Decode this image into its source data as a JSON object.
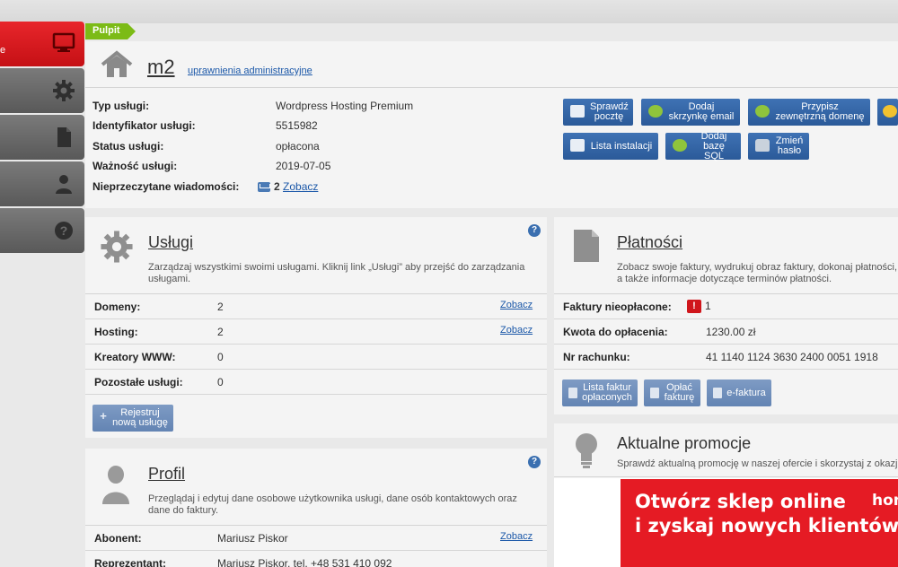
{
  "sidebar": {
    "items": [
      {
        "label": "e",
        "icon": "monitor-icon",
        "active": true
      },
      {
        "label": "",
        "icon": "gear-icon"
      },
      {
        "label": "",
        "icon": "document-icon"
      },
      {
        "label": "",
        "icon": "user-icon"
      },
      {
        "label": "",
        "icon": "help-icon"
      }
    ]
  },
  "breadcrumb": {
    "label": "Pulpit"
  },
  "summary": {
    "service_name": "m2",
    "permissions_link": "uprawnienia administracyjne",
    "rows": [
      {
        "key": "Typ usługi:",
        "value": "Wordpress Hosting Premium"
      },
      {
        "key": "Identyfikator usługi:",
        "value": "5515982"
      },
      {
        "key": "Status usługi:",
        "value": "opłacona"
      },
      {
        "key": "Ważność usługi:",
        "value": "2019-07-05"
      }
    ],
    "unread": {
      "key": "Nieprzeczytane wiadomości:",
      "count": "2",
      "link": "Zobacz"
    }
  },
  "quick_actions": [
    {
      "label": "Sprawdź pocztę",
      "icon": "mail-icon"
    },
    {
      "label": "Dodaj skrzynkę email",
      "icon": "add-mailbox-icon"
    },
    {
      "label": "Przypisz zewnętrzną domenę",
      "icon": "domain-icon"
    },
    {
      "label": "",
      "icon": "lightbulb-icon"
    },
    {
      "label": "Lista instalacji",
      "icon": "install-list-icon"
    },
    {
      "label": "Dodaj bazę SQL",
      "icon": "database-icon"
    },
    {
      "label": "Zmień hasło",
      "icon": "lock-icon"
    }
  ],
  "uslugi": {
    "title": "Usługi",
    "description": "Zarządzaj wszystkimi swoimi usługami. Kliknij link „Usługi” aby przejść do zarządzania usługami.",
    "rows": [
      {
        "key": "Domeny:",
        "value": "2",
        "link": "Zobacz"
      },
      {
        "key": "Hosting:",
        "value": "2",
        "link": "Zobacz"
      },
      {
        "key": "Kreatory WWW:",
        "value": "0",
        "link": ""
      },
      {
        "key": "Pozostałe usługi:",
        "value": "0",
        "link": ""
      }
    ],
    "register_button": "Rejestruj nową usługę"
  },
  "platnosci": {
    "title": "Płatności",
    "description": "Zobacz swoje faktury, wydrukuj obraz faktury, dokonaj płatności, a także informacje dotyczące terminów płatności.",
    "rows": [
      {
        "key": "Faktury nieopłacone:",
        "value": "1"
      },
      {
        "key": "Kwota do opłacenia:",
        "value": "1230.00 zł"
      },
      {
        "key": "Nr rachunku:",
        "value": "41 1140 1124 3630 2400 0051 1918"
      }
    ],
    "buttons": [
      "Lista faktur opłaconych",
      "Opłać fakturę",
      "e-faktura"
    ]
  },
  "profil": {
    "title": "Profil",
    "description": "Przeglądaj i edytuj dane osobowe użytkownika usługi, dane osób kontaktowych oraz dane do faktury.",
    "rows": [
      {
        "key": "Abonent:",
        "value": "Mariusz Piskor",
        "link": "Zobacz"
      },
      {
        "key": "Reprezentant:",
        "value": "Mariusz Piskor, tel. +48 531 410 092",
        "link": ""
      }
    ]
  },
  "promocje": {
    "title": "Aktualne promocje",
    "description": "Sprawdź aktualną promocję w naszej ofercie i skorzystaj z okazji",
    "banner_line1": "Otwórz sklep online",
    "banner_line2": "i zyskaj nowych klientów",
    "banner_brand": "hom"
  },
  "colors": {
    "accent_red": "#e51b24",
    "primary_blue": "#2b5a99",
    "breadcrumb_green": "#7cbb16"
  }
}
